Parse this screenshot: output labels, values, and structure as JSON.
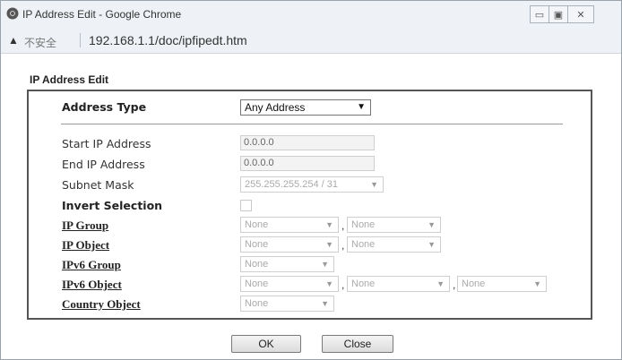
{
  "window": {
    "title": "IP Address Edit - Google Chrome",
    "controls": {
      "minimize": "▭",
      "maximize": "▣",
      "close": "✕"
    }
  },
  "addressbar": {
    "security_label": "不安全",
    "url": "192.168.1.1/doc/ipfipedt.htm"
  },
  "page": {
    "section_title": "IP Address Edit",
    "address_type": {
      "label": "Address Type",
      "value": "Any Address"
    },
    "start_ip": {
      "label": "Start IP Address",
      "value": "0.0.0.0"
    },
    "end_ip": {
      "label": "End IP Address",
      "value": "0.0.0.0"
    },
    "subnet_mask": {
      "label": "Subnet Mask",
      "value": "255.255.255.254 / 31"
    },
    "invert_selection": {
      "label": "Invert Selection",
      "checked": false
    },
    "ip_group": {
      "label": "IP Group",
      "values": [
        "None",
        "None"
      ]
    },
    "ip_object": {
      "label": "IP Object",
      "values": [
        "None",
        "None"
      ]
    },
    "ipv6_group": {
      "label": "IPv6 Group",
      "values": [
        "None"
      ]
    },
    "ipv6_object": {
      "label": "IPv6 Object",
      "values": [
        "None",
        "None",
        "None"
      ]
    },
    "country_object": {
      "label": "Country Object",
      "values": [
        "None"
      ]
    },
    "separator": ","
  },
  "buttons": {
    "ok": "OK",
    "close": "Close"
  },
  "icons": {
    "chrome": "chrome-logo-icon",
    "warning": "warning-triangle-icon",
    "dropdown": "chevron-down-icon"
  },
  "colors": {
    "titlebar": "#eef2f6",
    "panel_border": "#555555",
    "disabled_text": "#aaaaaa"
  }
}
